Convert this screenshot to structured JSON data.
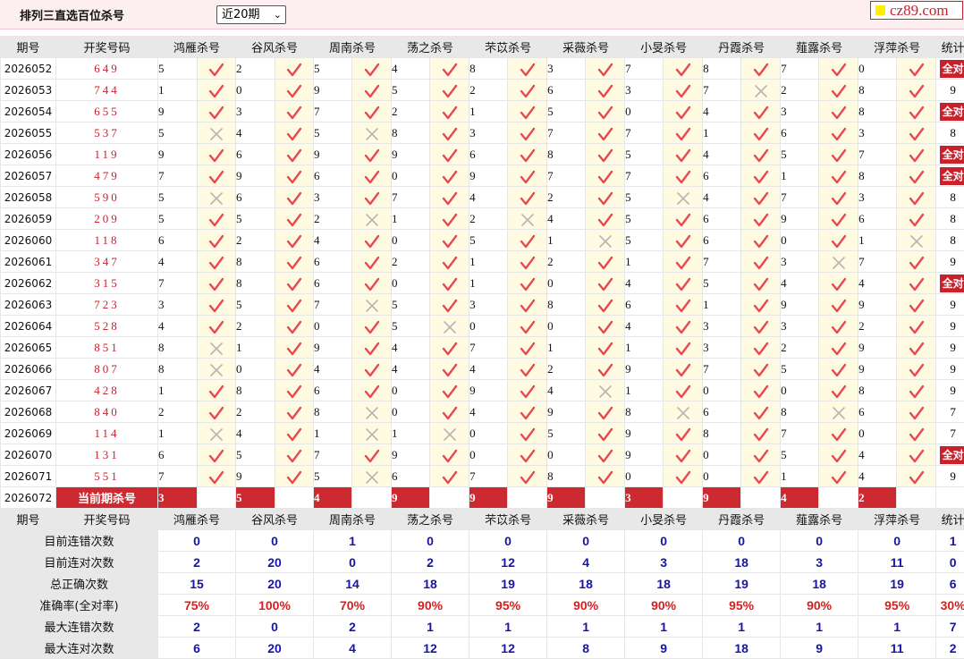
{
  "header": {
    "title": "排列三直选百位杀号",
    "period_select": "近20期",
    "logo_text": "cz89.com",
    "colors": {
      "accent_red": "#c9202b",
      "summary_blue": "#1515a8",
      "cell_bg": "#fffbe3"
    }
  },
  "columns": {
    "issue": "期号",
    "draw": "开奖号码",
    "experts": [
      "鸿雁杀号",
      "谷风杀号",
      "周南杀号",
      "荡之杀号",
      "芣苡杀号",
      "采薇杀号",
      "小旻杀号",
      "丹霞杀号",
      "薤露杀号",
      "浮萍杀号"
    ],
    "stat": "统计"
  },
  "rows": [
    {
      "issue": "2026052",
      "draw": "649",
      "kills": [
        "5",
        "2",
        "5",
        "4",
        "8",
        "3",
        "7",
        "8",
        "7",
        "0"
      ],
      "marks": [
        1,
        1,
        1,
        1,
        1,
        1,
        1,
        1,
        1,
        1
      ],
      "stat": "全对"
    },
    {
      "issue": "2026053",
      "draw": "744",
      "kills": [
        "1",
        "0",
        "9",
        "5",
        "2",
        "6",
        "3",
        "7",
        "2",
        "8"
      ],
      "marks": [
        1,
        1,
        1,
        1,
        1,
        1,
        1,
        0,
        1,
        1
      ],
      "stat": "9"
    },
    {
      "issue": "2026054",
      "draw": "655",
      "kills": [
        "9",
        "3",
        "7",
        "2",
        "1",
        "5",
        "0",
        "4",
        "3",
        "8"
      ],
      "marks": [
        1,
        1,
        1,
        1,
        1,
        1,
        1,
        1,
        1,
        1
      ],
      "stat": "全对"
    },
    {
      "issue": "2026055",
      "draw": "537",
      "kills": [
        "5",
        "4",
        "5",
        "8",
        "3",
        "7",
        "7",
        "1",
        "6",
        "3"
      ],
      "marks": [
        0,
        1,
        0,
        1,
        1,
        1,
        1,
        1,
        1,
        1
      ],
      "stat": "8"
    },
    {
      "issue": "2026056",
      "draw": "119",
      "kills": [
        "9",
        "6",
        "9",
        "9",
        "6",
        "8",
        "5",
        "4",
        "5",
        "7"
      ],
      "marks": [
        1,
        1,
        1,
        1,
        1,
        1,
        1,
        1,
        1,
        1
      ],
      "stat": "全对"
    },
    {
      "issue": "2026057",
      "draw": "479",
      "kills": [
        "7",
        "9",
        "6",
        "0",
        "9",
        "7",
        "7",
        "6",
        "1",
        "8"
      ],
      "marks": [
        1,
        1,
        1,
        1,
        1,
        1,
        1,
        1,
        1,
        1
      ],
      "stat": "全对"
    },
    {
      "issue": "2026058",
      "draw": "590",
      "kills": [
        "5",
        "6",
        "3",
        "7",
        "4",
        "2",
        "5",
        "4",
        "7",
        "3"
      ],
      "marks": [
        0,
        1,
        1,
        1,
        1,
        1,
        0,
        1,
        1,
        1
      ],
      "stat": "8"
    },
    {
      "issue": "2026059",
      "draw": "209",
      "kills": [
        "5",
        "5",
        "2",
        "1",
        "2",
        "4",
        "5",
        "6",
        "9",
        "6"
      ],
      "marks": [
        1,
        1,
        0,
        1,
        0,
        1,
        1,
        1,
        1,
        1
      ],
      "stat": "8"
    },
    {
      "issue": "2026060",
      "draw": "118",
      "kills": [
        "6",
        "2",
        "4",
        "0",
        "5",
        "1",
        "5",
        "6",
        "0",
        "1"
      ],
      "marks": [
        1,
        1,
        1,
        1,
        1,
        0,
        1,
        1,
        1,
        0
      ],
      "stat": "8"
    },
    {
      "issue": "2026061",
      "draw": "347",
      "kills": [
        "4",
        "8",
        "6",
        "2",
        "1",
        "2",
        "1",
        "7",
        "3",
        "7"
      ],
      "marks": [
        1,
        1,
        1,
        1,
        1,
        1,
        1,
        1,
        0,
        1
      ],
      "stat": "9"
    },
    {
      "issue": "2026062",
      "draw": "315",
      "kills": [
        "7",
        "8",
        "6",
        "0",
        "1",
        "0",
        "4",
        "5",
        "4",
        "4"
      ],
      "marks": [
        1,
        1,
        1,
        1,
        1,
        1,
        1,
        1,
        1,
        1
      ],
      "stat": "全对"
    },
    {
      "issue": "2026063",
      "draw": "723",
      "kills": [
        "3",
        "5",
        "7",
        "5",
        "3",
        "8",
        "6",
        "1",
        "9",
        "9"
      ],
      "marks": [
        1,
        1,
        0,
        1,
        1,
        1,
        1,
        1,
        1,
        1
      ],
      "stat": "9"
    },
    {
      "issue": "2026064",
      "draw": "528",
      "kills": [
        "4",
        "2",
        "0",
        "5",
        "0",
        "0",
        "4",
        "3",
        "3",
        "2"
      ],
      "marks": [
        1,
        1,
        1,
        0,
        1,
        1,
        1,
        1,
        1,
        1
      ],
      "stat": "9"
    },
    {
      "issue": "2026065",
      "draw": "851",
      "kills": [
        "8",
        "1",
        "9",
        "4",
        "7",
        "1",
        "1",
        "3",
        "2",
        "9"
      ],
      "marks": [
        0,
        1,
        1,
        1,
        1,
        1,
        1,
        1,
        1,
        1
      ],
      "stat": "9"
    },
    {
      "issue": "2026066",
      "draw": "807",
      "kills": [
        "8",
        "0",
        "4",
        "4",
        "4",
        "2",
        "9",
        "7",
        "5",
        "9"
      ],
      "marks": [
        0,
        1,
        1,
        1,
        1,
        1,
        1,
        1,
        1,
        1
      ],
      "stat": "9"
    },
    {
      "issue": "2026067",
      "draw": "428",
      "kills": [
        "1",
        "8",
        "6",
        "0",
        "9",
        "4",
        "1",
        "0",
        "0",
        "8"
      ],
      "marks": [
        1,
        1,
        1,
        1,
        1,
        0,
        1,
        1,
        1,
        1
      ],
      "stat": "9"
    },
    {
      "issue": "2026068",
      "draw": "840",
      "kills": [
        "2",
        "2",
        "8",
        "0",
        "4",
        "9",
        "8",
        "6",
        "8",
        "6"
      ],
      "marks": [
        1,
        1,
        0,
        1,
        1,
        1,
        0,
        1,
        0,
        1
      ],
      "stat": "7"
    },
    {
      "issue": "2026069",
      "draw": "114",
      "kills": [
        "1",
        "4",
        "1",
        "1",
        "0",
        "5",
        "9",
        "8",
        "7",
        "0"
      ],
      "marks": [
        0,
        1,
        0,
        0,
        1,
        1,
        1,
        1,
        1,
        1
      ],
      "stat": "7"
    },
    {
      "issue": "2026070",
      "draw": "131",
      "kills": [
        "6",
        "5",
        "7",
        "9",
        "0",
        "0",
        "9",
        "0",
        "5",
        "4"
      ],
      "marks": [
        1,
        1,
        1,
        1,
        1,
        1,
        1,
        1,
        1,
        1
      ],
      "stat": "全对"
    },
    {
      "issue": "2026071",
      "draw": "551",
      "kills": [
        "7",
        "9",
        "5",
        "6",
        "7",
        "8",
        "0",
        "0",
        "1",
        "4"
      ],
      "marks": [
        1,
        1,
        0,
        1,
        1,
        1,
        1,
        1,
        1,
        1
      ],
      "stat": "9"
    }
  ],
  "current": {
    "issue": "2026072",
    "label": "当前期杀号",
    "kills": [
      "3",
      "5",
      "4",
      "9",
      "9",
      "9",
      "3",
      "9",
      "4",
      "2"
    ]
  },
  "summary": [
    {
      "label": "目前连错次数",
      "values": [
        "0",
        "0",
        "1",
        "0",
        "0",
        "0",
        "0",
        "0",
        "0",
        "0",
        "1"
      ]
    },
    {
      "label": "目前连对次数",
      "values": [
        "2",
        "20",
        "0",
        "2",
        "12",
        "4",
        "3",
        "18",
        "3",
        "11",
        "0"
      ]
    },
    {
      "label": "总正确次数",
      "values": [
        "15",
        "20",
        "14",
        "18",
        "19",
        "18",
        "18",
        "19",
        "18",
        "19",
        "6"
      ]
    },
    {
      "label": "准确率(全对率)",
      "values": [
        "75%",
        "100%",
        "70%",
        "90%",
        "95%",
        "90%",
        "90%",
        "95%",
        "90%",
        "95%",
        "30%"
      ],
      "rate": true
    },
    {
      "label": "最大连错次数",
      "values": [
        "2",
        "0",
        "2",
        "1",
        "1",
        "1",
        "1",
        "1",
        "1",
        "1",
        "7"
      ]
    },
    {
      "label": "最大连对次数",
      "values": [
        "6",
        "20",
        "4",
        "12",
        "12",
        "8",
        "9",
        "18",
        "9",
        "11",
        "2"
      ]
    }
  ]
}
